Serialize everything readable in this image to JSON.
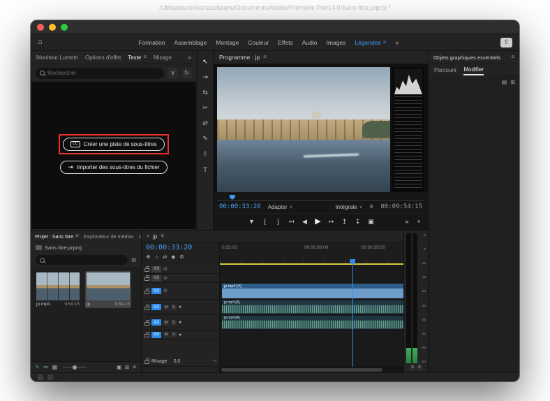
{
  "desktop": {
    "window_title": "/Utilisateurs/nicolaschaunu/Documents/Adobe/Premiere Pro/14.0/Sans titre.prproj *"
  },
  "colors": {
    "accent_blue": "#2d8ceb",
    "timecode_blue": "#49a0f7",
    "active_workspace_blue": "#3f9bfa",
    "highlight_red": "#e8312a",
    "work_area_yellow": "#d8c83e",
    "panel_background": "#232323"
  },
  "icons": {
    "home": "⌂",
    "panel_menu": "≡",
    "overflow": "»",
    "share": "⇧",
    "close": "×",
    "chevron_down": "∨",
    "refresh": "↻",
    "cc_badge": "CC",
    "import_arrow": "⇥",
    "tools": [
      "↖",
      "⇥",
      "⇆",
      "✂",
      "⇄",
      "✎",
      "✌",
      "T"
    ],
    "marker": "▼",
    "mark_in": "{",
    "mark_out": "}",
    "go_to_in": "↤",
    "step_back": "◀",
    "play": "▶",
    "step_forward": "▶",
    "go_to_out": "↦",
    "lift": "↥",
    "extract": "↧",
    "export_frame": "▣",
    "plus": "+",
    "settings": "⚙",
    "snap": "∩",
    "linked_selection": "⇄",
    "nest": "❖",
    "keyframe_marker": "◆",
    "eye": "⊙",
    "mic": "●",
    "pencil": "✎",
    "list_view": "≔",
    "icon_view": "▦",
    "new_bin": "▣",
    "new_item": "⊞",
    "trash": "✕",
    "folder": "▤",
    "keyframe_handle": "⊣"
  },
  "workspaces": {
    "items": [
      "Formation",
      "Assemblage",
      "Montage",
      "Couleur",
      "Effets",
      "Audio",
      "Images",
      "Légendes"
    ]
  },
  "left_panel": {
    "tabs": [
      "Moniteur Lumetri",
      "Options d'effet",
      "Texte",
      "Mixage"
    ],
    "search_placeholder": "Rechercher",
    "create_button": "Créer une piste de sous-titres",
    "import_button": "Importer des sous-titres du fichier"
  },
  "program": {
    "title": "Programme : jp",
    "timecode": "00:00:33:20",
    "zoom_level": "Adapter",
    "playback_resolution": "Intégrale",
    "duration": "00:09:54:15"
  },
  "project": {
    "tab_project": "Projet : Sans titre",
    "tab_media_browser": "Explorateur de médias",
    "project_file": "Sans titre.prproj",
    "clips": [
      {
        "name": "jp.mp4",
        "duration": "9:54:15"
      },
      {
        "name": "jp",
        "duration": "9:54:15"
      }
    ]
  },
  "timeline": {
    "tab": "jp",
    "timecode": "00:00:33:20",
    "ruler_labels": [
      "0:25:00",
      "00:00:30:00",
      "00:00:35:00"
    ],
    "video_tracks": [
      "V3",
      "V2",
      "V1"
    ],
    "audio_tracks": [
      "A1",
      "A2",
      "A3"
    ],
    "video_clip_label": "jp.mp4 [V]",
    "audio_clip_label": "jp.mp4 [A]",
    "mix_label": "Mixage",
    "mix_value": "0,0",
    "mute": "M",
    "solo": "S"
  },
  "meters": {
    "scale": [
      "0",
      "-6",
      "-12",
      "-18",
      "-24",
      "-30",
      "-36",
      "-42",
      "-48",
      "-54"
    ],
    "solo": "S"
  },
  "essential_graphics": {
    "title": "Objets graphiques essentiels",
    "tab_browse": "Parcourir",
    "tab_edit": "Modifier"
  }
}
